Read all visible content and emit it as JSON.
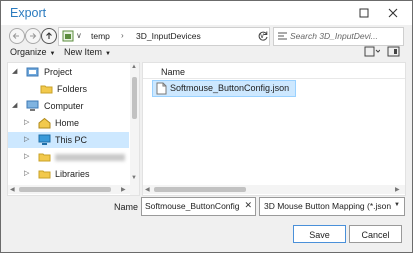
{
  "window": {
    "title": "Export"
  },
  "address": {
    "crumbs": [
      "temp",
      "3D_InputDevices"
    ]
  },
  "search": {
    "placeholder": "Search 3D_InputDevi..."
  },
  "toolbar": {
    "organize": "Organize",
    "new_item": "New Item"
  },
  "tree": {
    "items": [
      {
        "label": "Project",
        "icon": "project-icon"
      },
      {
        "label": "Folders",
        "icon": "folder-icon"
      },
      {
        "label": "Computer",
        "icon": "computer-icon"
      },
      {
        "label": "Home",
        "icon": "home-icon"
      },
      {
        "label": "This PC",
        "icon": "monitor-icon",
        "selected": true
      },
      {
        "label": "",
        "icon": "folder-icon"
      },
      {
        "label": "Libraries",
        "icon": "folder-icon"
      }
    ]
  },
  "file_list": {
    "column_header": "Name",
    "files": [
      {
        "name": "Softmouse_ButtonConfig.json",
        "icon": "file-icon"
      }
    ]
  },
  "footer": {
    "name_label": "Name",
    "file_name_value": "Softmouse_ButtonConfig",
    "file_type_value": "3D Mouse Button Mapping (*.json",
    "save_label": "Save",
    "cancel_label": "Cancel"
  },
  "colors": {
    "accent": "#2b7bbf",
    "selection": "#cde8ff"
  }
}
